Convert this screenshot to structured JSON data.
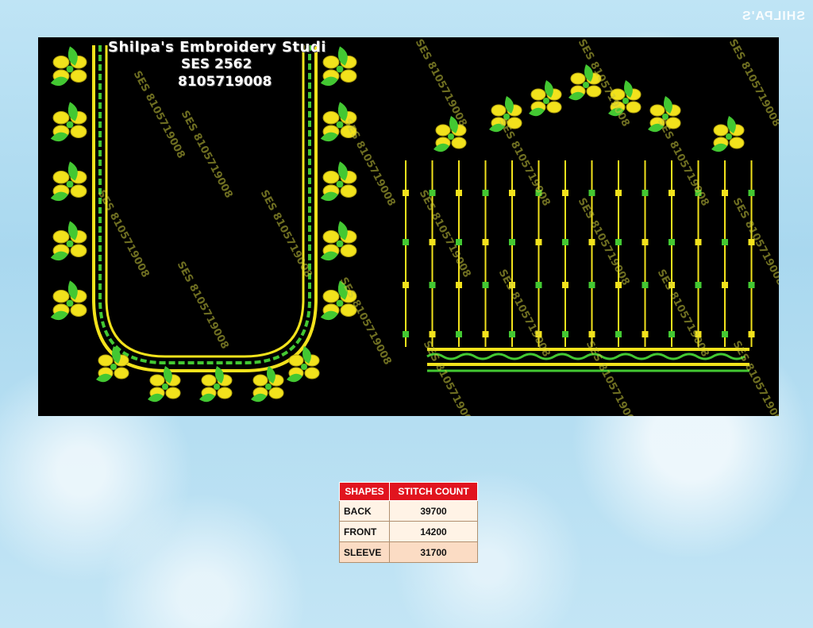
{
  "studio": {
    "name": "Shilpa's Embroidery Studi",
    "code": "SES 2562",
    "phone": "8105719008"
  },
  "watermark_text": "SES 8105719008",
  "corner_logo": "SHILPA'S",
  "table": {
    "headers": [
      "SHAPES",
      "STITCH COUNT"
    ],
    "rows": [
      {
        "shape": "BACK",
        "count": "39700"
      },
      {
        "shape": "FRONT",
        "count": "14200"
      },
      {
        "shape": "SLEEVE",
        "count": "31700"
      }
    ]
  },
  "colors": {
    "header_red": "#e1141e",
    "thread_yellow": "#f2e21c",
    "thread_green": "#43c832",
    "panel_black": "#000000"
  }
}
